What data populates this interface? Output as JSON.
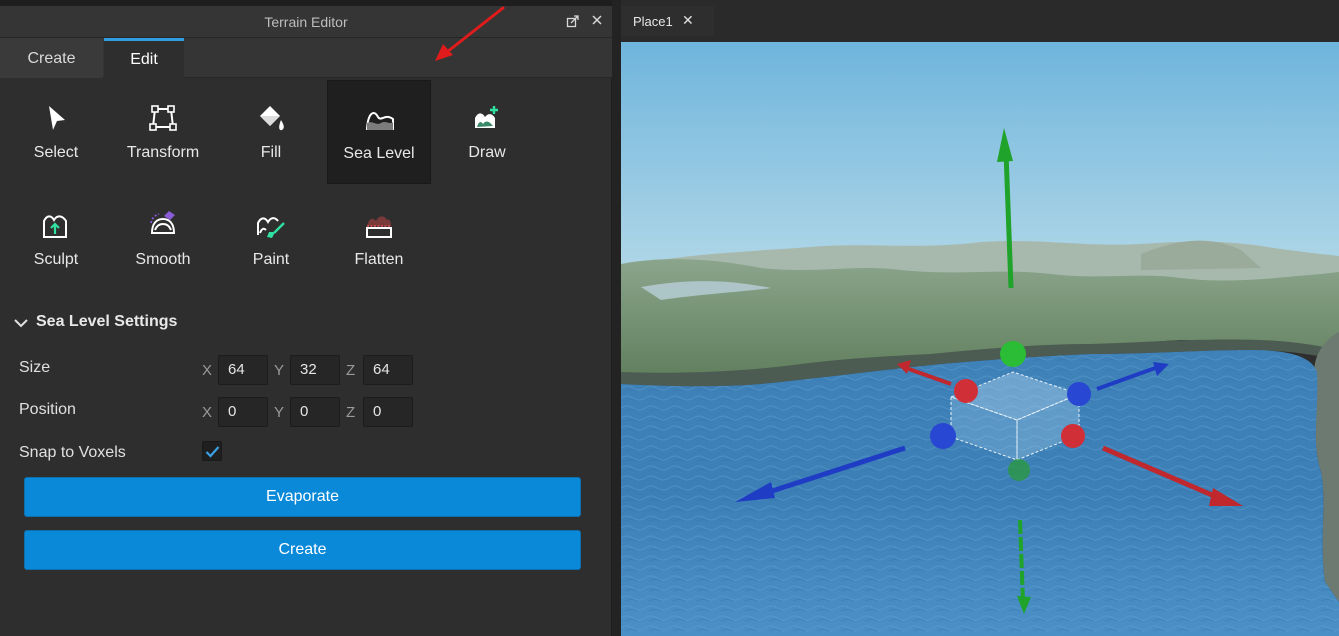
{
  "window": {
    "title": "Terrain Editor",
    "restore_icon": "restore-icon",
    "close_icon": "close-icon"
  },
  "tabs": [
    {
      "label": "Create",
      "active": false
    },
    {
      "label": "Edit",
      "active": true
    }
  ],
  "tools": [
    {
      "label": "Select",
      "icon": "cursor-icon",
      "active": false
    },
    {
      "label": "Transform",
      "icon": "transform-icon",
      "active": false
    },
    {
      "label": "Fill",
      "icon": "paint-bucket-icon",
      "active": false
    },
    {
      "label": "Sea Level",
      "icon": "sea-level-icon",
      "active": true
    },
    {
      "label": "Draw",
      "icon": "draw-terrain-icon",
      "active": false
    },
    {
      "label": "Sculpt",
      "icon": "sculpt-icon",
      "active": false
    },
    {
      "label": "Smooth",
      "icon": "smooth-icon",
      "active": false
    },
    {
      "label": "Paint",
      "icon": "paint-icon",
      "active": false
    },
    {
      "label": "Flatten",
      "icon": "flatten-icon",
      "active": false
    }
  ],
  "settings": {
    "title": "Sea Level Settings",
    "size": {
      "label": "Size",
      "x": "64",
      "y": "32",
      "z": "64"
    },
    "position": {
      "label": "Position",
      "x": "0",
      "y": "0",
      "z": "0"
    },
    "axes": {
      "x": "X",
      "y": "Y",
      "z": "Z"
    },
    "snap": {
      "label": "Snap to Voxels",
      "checked": true
    }
  },
  "buttons": {
    "evaporate": "Evaporate",
    "create": "Create"
  },
  "document": {
    "tab_label": "Place1",
    "tab_close": "✕"
  },
  "colors": {
    "accent": "#0a89d8",
    "tab_indicator": "#2f9de0",
    "annotation_arrow": "#e01b1b",
    "gizmo_x": "#c0282e",
    "gizmo_y": "#1fa32a",
    "gizmo_z": "#1f3cc4"
  }
}
